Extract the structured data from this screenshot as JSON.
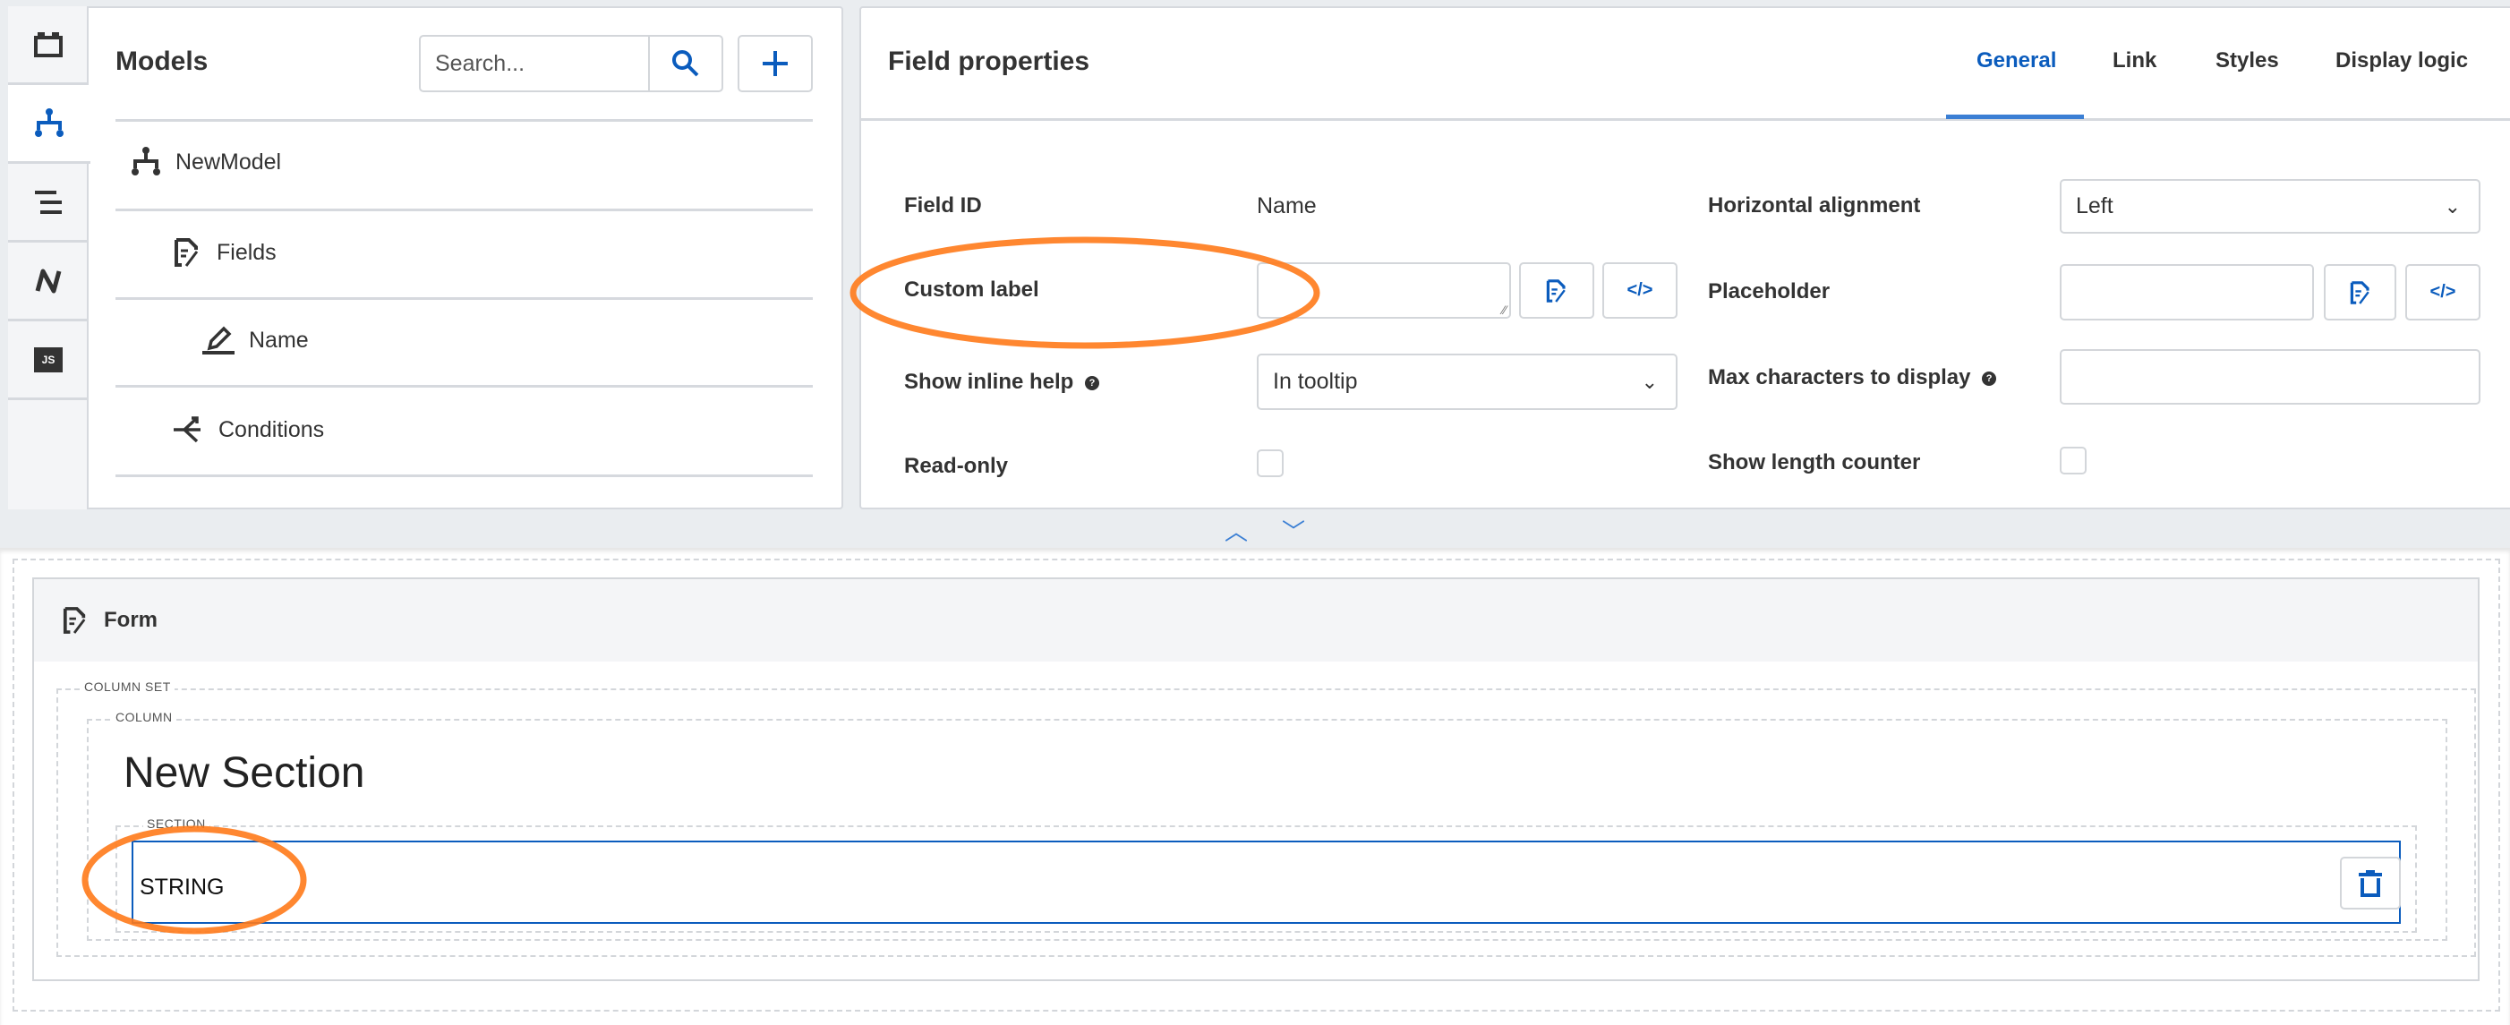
{
  "left_rail": {
    "items": [
      {
        "icon": "component-icon"
      },
      {
        "icon": "model-tree-icon",
        "active": true
      },
      {
        "icon": "outline-icon"
      },
      {
        "icon": "flow-icon"
      },
      {
        "icon": "js-icon",
        "label": "JS"
      }
    ]
  },
  "models": {
    "title": "Models",
    "search_placeholder": "Search...",
    "tree": [
      {
        "label": "NewModel",
        "icon": "model-tree-icon"
      },
      {
        "label": "Fields",
        "icon": "form-icon"
      },
      {
        "label": "Name",
        "icon": "pencil-icon"
      },
      {
        "label": "Conditions",
        "icon": "split-icon"
      }
    ]
  },
  "field_properties": {
    "title": "Field properties",
    "tabs": [
      {
        "label": "General",
        "active": true
      },
      {
        "label": "Link"
      },
      {
        "label": "Styles"
      },
      {
        "label": "Display logic"
      }
    ],
    "field_id_label": "Field ID",
    "field_id_value": "Name",
    "custom_label_label": "Custom label",
    "custom_label_value": "",
    "show_inline_help_label": "Show inline help",
    "show_inline_help_value": "In tooltip",
    "read_only_label": "Read-only",
    "read_only_checked": false,
    "horizontal_alignment_label": "Horizontal alignment",
    "horizontal_alignment_value": "Left",
    "placeholder_label": "Placeholder",
    "placeholder_value": "",
    "max_chars_label": "Max characters to display",
    "max_chars_value": "",
    "show_length_counter_label": "Show length counter",
    "show_length_counter_checked": false
  },
  "form": {
    "title": "Form",
    "column_set_label": "COLUMN SET",
    "column_label": "COLUMN",
    "section_title": "New Section",
    "section_label": "SECTION",
    "field_label": "STRING"
  },
  "colors": {
    "accent": "#0b5cbd",
    "annotation": "#ff7a1a"
  }
}
